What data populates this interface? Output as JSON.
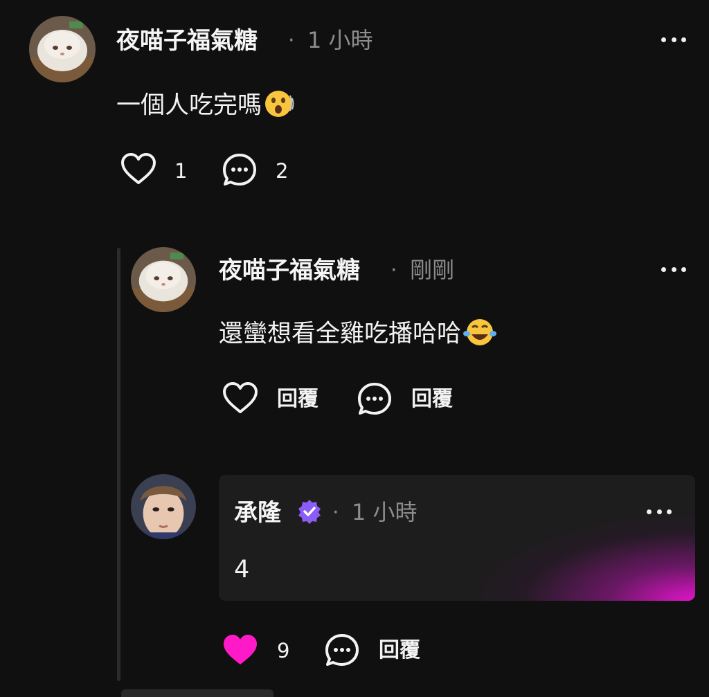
{
  "comment": {
    "author": "夜喵子福氣糖",
    "separator": "·",
    "time": "1 小時",
    "text": "一個人吃完嗎",
    "emoji": "astonished-face",
    "likes": "1",
    "replies": "2"
  },
  "reply": {
    "author": "夜喵子福氣糖",
    "separator": "·",
    "time": "剛剛",
    "text": "還蠻想看全雞吃播哈哈",
    "emoji": "tears-of-joy-face",
    "like_label": "回覆",
    "reply_label": "回覆"
  },
  "pinned": {
    "author": "承隆",
    "verified": true,
    "separator": "·",
    "time": "1 小時",
    "text": "4",
    "likes": "9",
    "reply_label": "回覆"
  },
  "colors": {
    "background": "#101010",
    "like_active": "#ff1ac8",
    "verified": "#8b5cf6",
    "card_glow": "#e414d2"
  }
}
